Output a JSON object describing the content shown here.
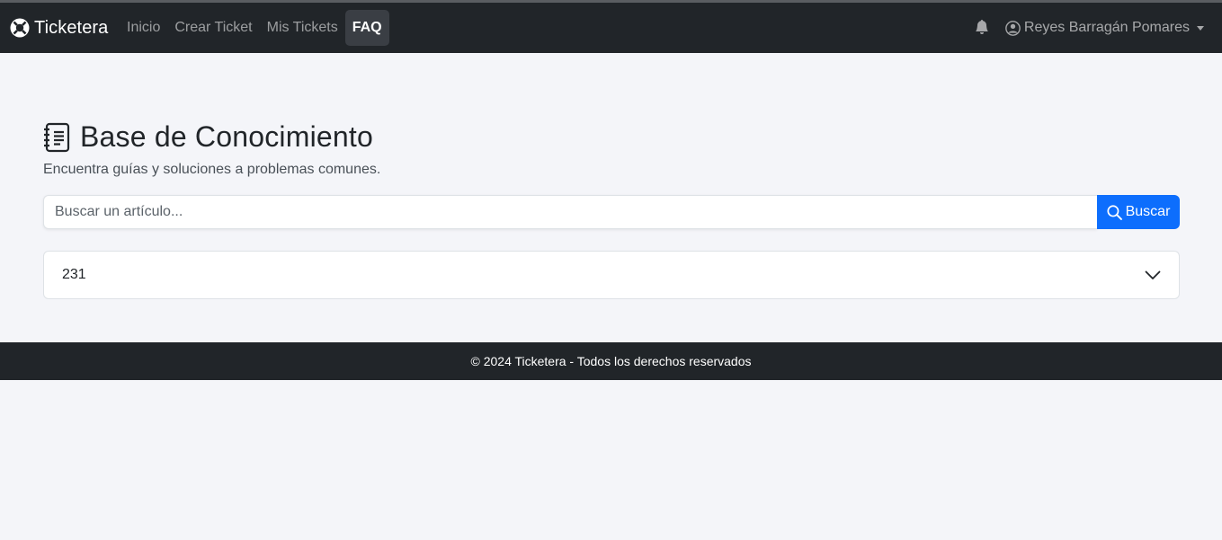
{
  "navbar": {
    "brand": "Ticketera",
    "links": [
      {
        "label": "Inicio",
        "active": false
      },
      {
        "label": "Crear Ticket",
        "active": false
      },
      {
        "label": "Mis Tickets",
        "active": false
      },
      {
        "label": "FAQ",
        "active": true
      }
    ],
    "user_name": "Reyes Barragán Pomares"
  },
  "page": {
    "title": "Base de Conocimiento",
    "subtitle": "Encuentra guías y soluciones a problemas comunes."
  },
  "search": {
    "placeholder": "Buscar un artículo...",
    "value": "",
    "button_label": "Buscar"
  },
  "faq_items": [
    {
      "question": "231",
      "expanded": false
    }
  ],
  "footer": {
    "text": "© 2024 Ticketera - Todos los derechos reservados"
  },
  "colors": {
    "navbar_bg": "#212529",
    "page_bg": "#f4f5f9",
    "primary": "#0d6efd"
  },
  "icons": {
    "brand": "life-ring-icon",
    "notifications": "bell-icon",
    "user": "person-circle-icon",
    "title": "journal-text-icon",
    "search": "search-icon",
    "accordion": "chevron-down-icon"
  }
}
